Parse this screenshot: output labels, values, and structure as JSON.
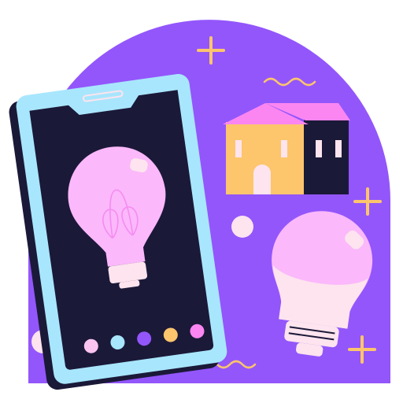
{
  "illustration": {
    "subject": "smart-home-lighting",
    "colors": {
      "background_arch": "#9356fb",
      "phone_frame": "#a8e6fd",
      "phone_shadow": "#1b1938",
      "phone_screen": "#1b1938",
      "bulb_glass": "#fbb8fb",
      "bulb_base": "#fde4ee",
      "house_wall": "#fdc56c",
      "house_roof": "#fb86f1",
      "house_dark": "#1b1938",
      "accent_yellow": "#fdc56c",
      "dot_light": "#fde4ee"
    },
    "color_swatches": [
      "#fbc4f0",
      "#a8e6fd",
      "#9356fb",
      "#fdc56c",
      "#fb86f1"
    ]
  }
}
